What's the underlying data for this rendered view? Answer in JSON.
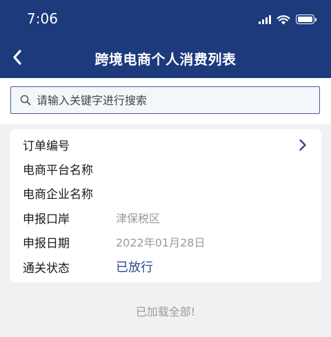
{
  "status_bar": {
    "time": "7:06",
    "icons": [
      "signal-icon",
      "wifi-icon",
      "battery-icon"
    ]
  },
  "header": {
    "title": "跨境电商个人消费列表",
    "back_icon": "chevron-left-icon",
    "background": "#1c3a7c"
  },
  "search": {
    "placeholder": "请输入关键字进行搜索",
    "value": "",
    "icon": "search-icon"
  },
  "order_card": {
    "rows": [
      {
        "label": "订单编号",
        "value": ""
      },
      {
        "label": "电商平台名称",
        "value": ""
      },
      {
        "label": "电商企业名称",
        "value": ""
      },
      {
        "label": "申报口岸",
        "value": "津保税区"
      },
      {
        "label": "申报日期",
        "value": "2022年01月28日"
      },
      {
        "label": "通关状态",
        "value": "已放行"
      }
    ],
    "status_color": "#2b4a8f",
    "detail_icon": "chevron-right-icon"
  },
  "footer": {
    "text": "已加载全部!"
  }
}
